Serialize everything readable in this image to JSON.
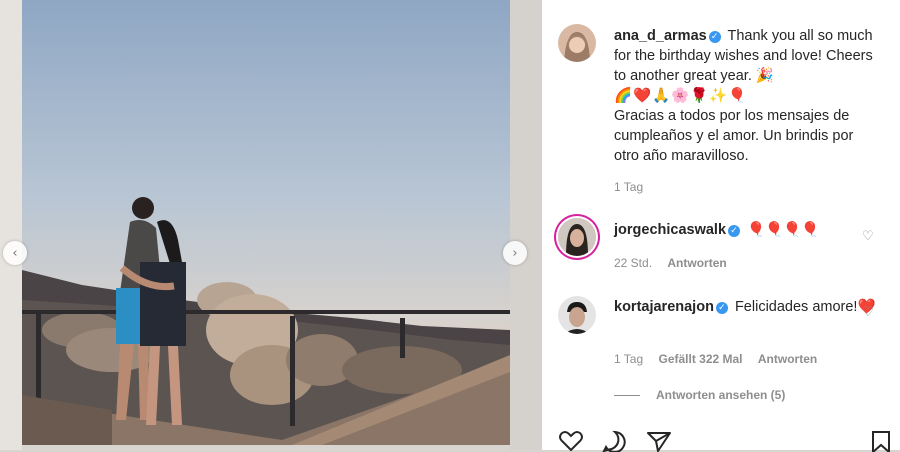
{
  "post": {
    "username": "ana_d_armas",
    "caption_en": "Thank you all so much for the birthday wishes and love! Cheers to another great year. 🎉",
    "caption_emojis": "🌈❤️🙏🌸🌹✨🎈",
    "caption_es": "Gracias a todos por los mensajes de cumpleaños y el amor. Un brindis por otro año maravilloso.",
    "time": "1 Tag"
  },
  "comments": [
    {
      "username": "jorgechicaswalk",
      "text": "🎈🎈🎈🎈",
      "time": "22 Std.",
      "reply_label": "Antworten"
    },
    {
      "username": "kortajarenajon",
      "text": "Felicidades amore!❤️",
      "time": "1 Tag",
      "likes": "Gefällt 322 Mal",
      "reply_label": "Antworten"
    }
  ],
  "view_replies": "Antworten ansehen (5)",
  "icons": {
    "verified": "verified-badge-icon",
    "like": "heart-icon",
    "comment": "comment-bubble-icon",
    "share": "paper-plane-icon",
    "save": "bookmark-icon",
    "prev": "chevron-left-icon",
    "next": "chevron-right-icon"
  },
  "colors": {
    "verified": "#3897f0",
    "meta_text": "#8e8e8e",
    "text": "#262626"
  }
}
